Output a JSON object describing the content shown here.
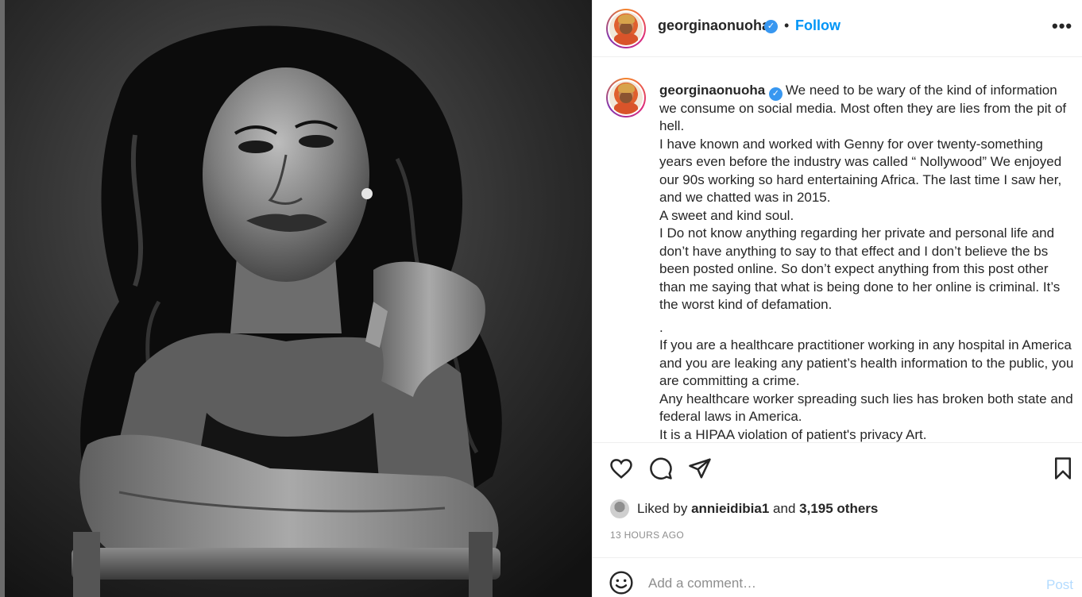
{
  "post": {
    "username": "georginaonuoha",
    "verified_icon": "verified-badge-icon",
    "separator": "•",
    "follow_label": "Follow",
    "more_icon": "more-options-icon",
    "more_glyph": "•••",
    "photo_alt": "Black and white portrait photo of a woman",
    "caption": {
      "username": "georginaonuoha",
      "lines": [
        "We need to be wary of the kind of information we consume on social media. Most often they are lies from the pit of hell.",
        "I have known and worked with Genny for over twenty-something years even before the industry was called “ Nollywood” We enjoyed our 90s working so hard entertaining Africa. The last time I saw her, and we chatted was in 2015.",
        "A sweet and kind soul.",
        "I Do not know anything regarding her private and personal life and don’t have anything to say to that effect and I don’t believe the bs been posted online. So don’t expect anything from this post other than me saying that what is being done to her online is criminal. It’s the worst kind of defamation.",
        ".",
        "If you are a healthcare practitioner working in any hospital in America and you are leaking any patient’s health information to the public, you are committing a crime.",
        "Any healthcare worker spreading such lies has broken both state and federal laws in America.",
        "It is a HIPAA violation of patient's privacy Art."
      ]
    },
    "actions": {
      "like_icon": "heart-icon",
      "comment_icon": "comment-icon",
      "share_icon": "share-icon",
      "save_icon": "bookmark-icon"
    },
    "likes": {
      "prefix": "Liked by",
      "user": "annieidibia1",
      "joiner": "and",
      "others": "3,195 others"
    },
    "timestamp": "13 HOURS AGO",
    "comment": {
      "emoji_icon": "emoji-icon",
      "placeholder": "Add a comment…",
      "post_label": "Post"
    }
  },
  "colors": {
    "accent": "#0095f6",
    "verified": "#3897f0",
    "post_disabled": "#b3dbff",
    "muted": "#8e8e8e",
    "text": "#262626"
  }
}
